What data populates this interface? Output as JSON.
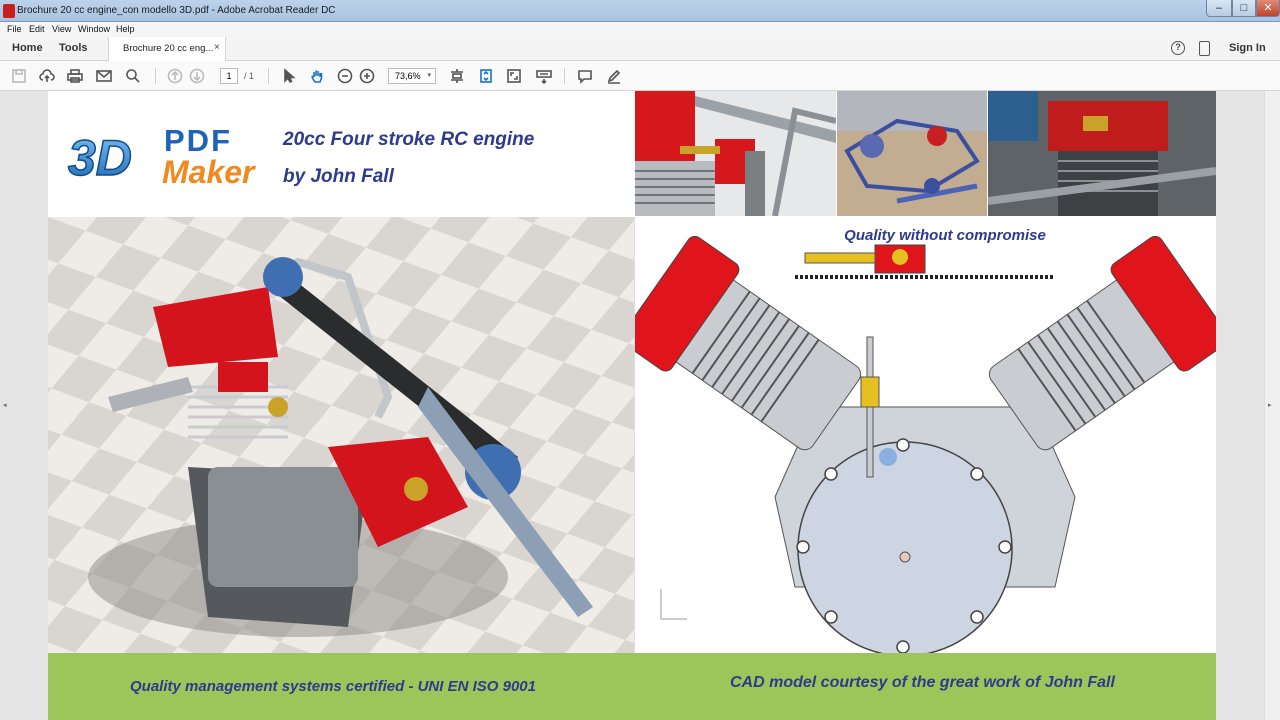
{
  "window": {
    "title": "Brochure 20 cc engine_con modello 3D.pdf - Adobe Acrobat Reader DC",
    "min_glyph": "–",
    "max_glyph": "□",
    "close_glyph": "✕"
  },
  "menu": [
    "File",
    "Edit",
    "View",
    "Window",
    "Help"
  ],
  "tabs": {
    "home": "Home",
    "tools": "Tools",
    "document": "Brochure 20 cc eng...",
    "close": "×",
    "help": "?",
    "signin": "Sign In"
  },
  "toolbar": {
    "page_current": "1",
    "page_total": "/ 1",
    "zoom": "73,6%",
    "zoom_dropdown": "▾"
  },
  "colors": {
    "accent_title": "#2e3a8c",
    "footer_green": "#9cc65a",
    "engine_red": "#d8141c"
  },
  "brochure": {
    "logo_text_1": "PDF",
    "logo_text_2": "Maker",
    "logo_3d": "3D",
    "title_line1": "20cc Four stroke RC engine",
    "title_line2": "by John Fall",
    "quality": "Quality without compromise",
    "footer_left": "Quality management systems certified - UNI EN ISO 9001",
    "footer_right": "CAD model courtesy of the great work of John Fall"
  },
  "handles": {
    "left": "◂",
    "right": "▸"
  }
}
